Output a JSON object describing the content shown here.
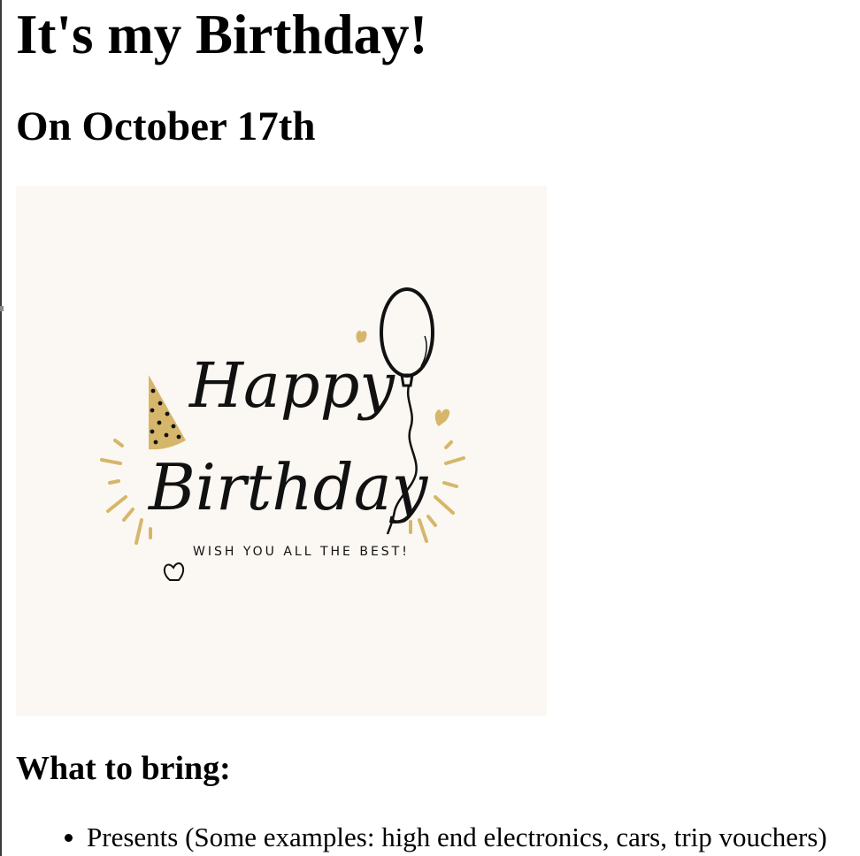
{
  "page": {
    "title": "It's my Birthday!",
    "date_heading": "On October 17th"
  },
  "card": {
    "script_line_1": "Happy",
    "script_line_2": "Birthday",
    "tagline": "WISH YOU ALL THE BEST!",
    "icons": [
      "party-hat-icon",
      "balloon-icon",
      "heart-icon",
      "sparkle-lines-icon"
    ],
    "colors": {
      "background": "#fbf8f3",
      "accent_gold": "#d6b66a",
      "ink": "#111111"
    }
  },
  "bring": {
    "heading": "What to bring:",
    "items": [
      "Presents (Some examples: high end electronics, cars, trip vouchers)"
    ]
  }
}
